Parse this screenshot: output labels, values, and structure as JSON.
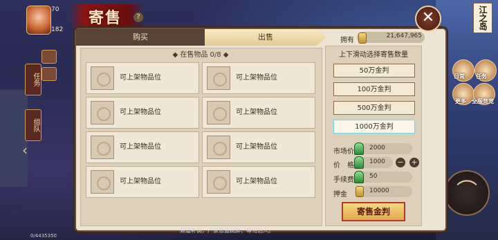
{
  "hud": {
    "level": "70",
    "sub_value": "182",
    "title": "寄售",
    "side_tab_task": "任务",
    "side_tab_team": "组队"
  },
  "right_hud": {
    "map_name": "江之岛",
    "daily_label": "日常",
    "task_label": "任务",
    "more_label": "更多",
    "all_label": "全服竞竞"
  },
  "panel": {
    "tab_buy": "购买",
    "tab_sell": "出售",
    "owned_label": "拥有",
    "owned_amount": "21,647,965",
    "close_symbol": "✕",
    "grid_title": "◆ 在售物品 0/8 ◆",
    "slots": [
      {
        "label": "可上架物品位"
      },
      {
        "label": "可上架物品位"
      },
      {
        "label": "可上架物品位"
      },
      {
        "label": "可上架物品位"
      },
      {
        "label": "可上架物品位"
      },
      {
        "label": "可上架物品位"
      },
      {
        "label": "可上架物品位"
      },
      {
        "label": "可上架物品位"
      }
    ],
    "right_title": "上下滑动选择寄售数量",
    "amounts": [
      "50万金判",
      "100万金判",
      "500万金判",
      "1000万金判"
    ],
    "selected_amount_index": 3,
    "market_price_label": "市场价",
    "market_price": "2000",
    "price_label": "价　格",
    "price": "1000",
    "fee_label": "手续费",
    "fee": "50",
    "deposit_label": "押金",
    "deposit": "10000",
    "sell_button": "寄售金判"
  },
  "footer": {
    "chat_text": "频道补调，广景悲意刷屏、辱骂他人。",
    "left_text": "0/4435350"
  },
  "colors": {
    "panel_bg": "#ece4d4",
    "tab_active": "#e4cb96",
    "tab_inactive": "#574336",
    "accent_red": "#b03a2a"
  }
}
